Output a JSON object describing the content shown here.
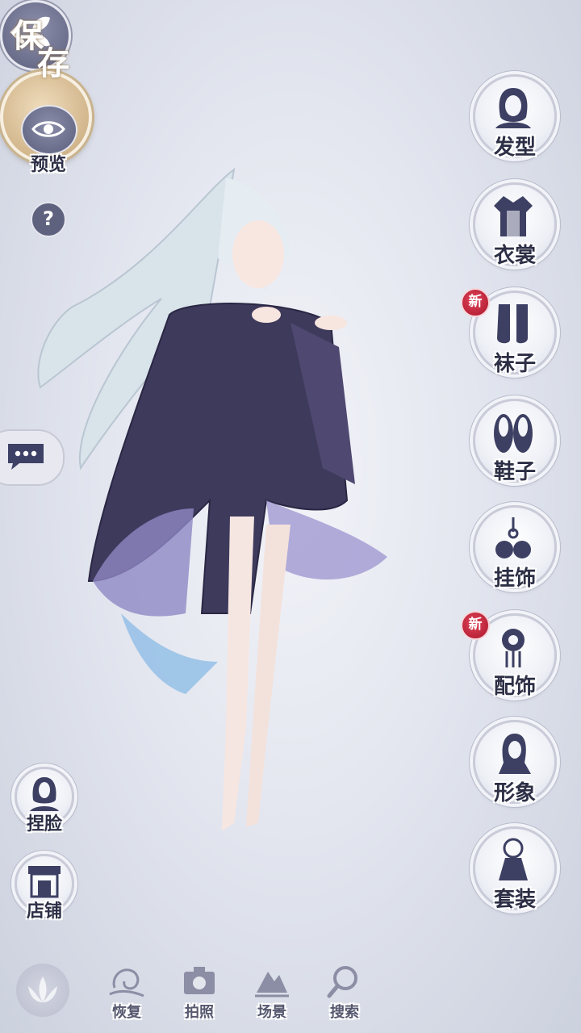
{
  "top": {
    "preview_label": "预览",
    "help_symbol": "?"
  },
  "menu": [
    {
      "label": "发型",
      "icon": "hairstyle-icon",
      "new": false
    },
    {
      "label": "衣裳",
      "icon": "clothes-icon",
      "new": false
    },
    {
      "label": "袜子",
      "icon": "socks-icon",
      "new": true
    },
    {
      "label": "鞋子",
      "icon": "shoes-icon",
      "new": false
    },
    {
      "label": "挂饰",
      "icon": "pendant-icon",
      "new": false
    },
    {
      "label": "配饰",
      "icon": "accessory-icon",
      "new": true
    },
    {
      "label": "形象",
      "icon": "appearance-icon",
      "new": false
    },
    {
      "label": "套装",
      "icon": "outfit-set-icon",
      "new": false
    }
  ],
  "new_badge_text": "新",
  "left": {
    "face_label": "捏脸",
    "shop_label": "店铺"
  },
  "toolbar": {
    "restore": "恢复",
    "photo": "拍照",
    "scene": "场景",
    "search": "搜索"
  },
  "save": {
    "char1": "保",
    "char2": "存"
  },
  "colors": {
    "badge": "#c81e34",
    "save_gold": "#d2b68c",
    "icon_navy": "#3d4063"
  }
}
